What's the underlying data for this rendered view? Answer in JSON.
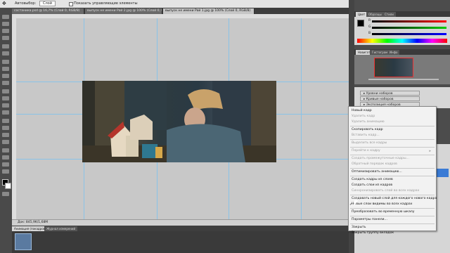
{
  "options_bar": {
    "auto_select": "Автовыбор:",
    "layer_value": "Слой",
    "show_controls": "Показать управляющие элементы"
  },
  "doc_tabs": [
    "состаника.psd @ 16,7% (Слой 0, RGB/8)",
    "выпуск не имени Рай 2.jpg @ 100% (Слой 0, RGB/8)",
    "выпуск не имени Рай 1.jpg @ 100% (Слой 0, RGB/8)"
  ],
  "status_bar": {
    "text": "Док: 845,9K/1,68M"
  },
  "animation_tabs": [
    "Анимация (покадровая)",
    "Журнал измерений"
  ],
  "color_panel": {
    "tabs": [
      "Цвет",
      "Образцы",
      "Стили"
    ],
    "channels": [
      "R",
      "G",
      "B"
    ]
  },
  "navigator_panel": {
    "tabs": [
      "Навигатор",
      "Гистограмма",
      "Инфо"
    ]
  },
  "adjustment_presets": [
    "Уровни наборов",
    "Кривые наборов",
    "Экспозиция наборов"
  ],
  "context_menu": {
    "items": [
      {
        "label": "Новый кадр",
        "disabled": false
      },
      {
        "label": "Удалить кадр",
        "disabled": true
      },
      {
        "label": "Удалить анимацию",
        "disabled": true
      },
      {
        "sep": true
      },
      {
        "label": "Скопировать кадр",
        "disabled": false
      },
      {
        "label": "Вставить кадр...",
        "disabled": true
      },
      {
        "sep": true
      },
      {
        "label": "Выделить все кадры",
        "disabled": true
      },
      {
        "sep": true
      },
      {
        "label": "Перейти к кадру",
        "disabled": true,
        "submenu": true
      },
      {
        "sep": true
      },
      {
        "label": "Создать промежуточные кадры...",
        "disabled": true
      },
      {
        "label": "Обратный порядок кадров",
        "disabled": true
      },
      {
        "sep": true
      },
      {
        "label": "Оптимизировать анимацию...",
        "disabled": false
      },
      {
        "sep": true
      },
      {
        "label": "Создать кадры из слоев",
        "disabled": false
      },
      {
        "label": "Создать слои из кадров",
        "disabled": false
      },
      {
        "label": "Синхронизировать слой во всех кадрах",
        "disabled": true
      },
      {
        "sep": true
      },
      {
        "label": "Создавать новый слой для каждого нового кадра",
        "disabled": false
      },
      {
        "label": "Новые слои видимы во всех кадрах",
        "disabled": false,
        "checked": true
      },
      {
        "sep": true
      },
      {
        "label": "Преобразовать во временную шкалу",
        "disabled": false
      },
      {
        "sep": true
      },
      {
        "label": "Параметры панели...",
        "disabled": false
      },
      {
        "sep": true
      },
      {
        "label": "Закрыть",
        "disabled": false
      },
      {
        "label": "Закрыть группу вкладок",
        "disabled": false
      }
    ]
  }
}
